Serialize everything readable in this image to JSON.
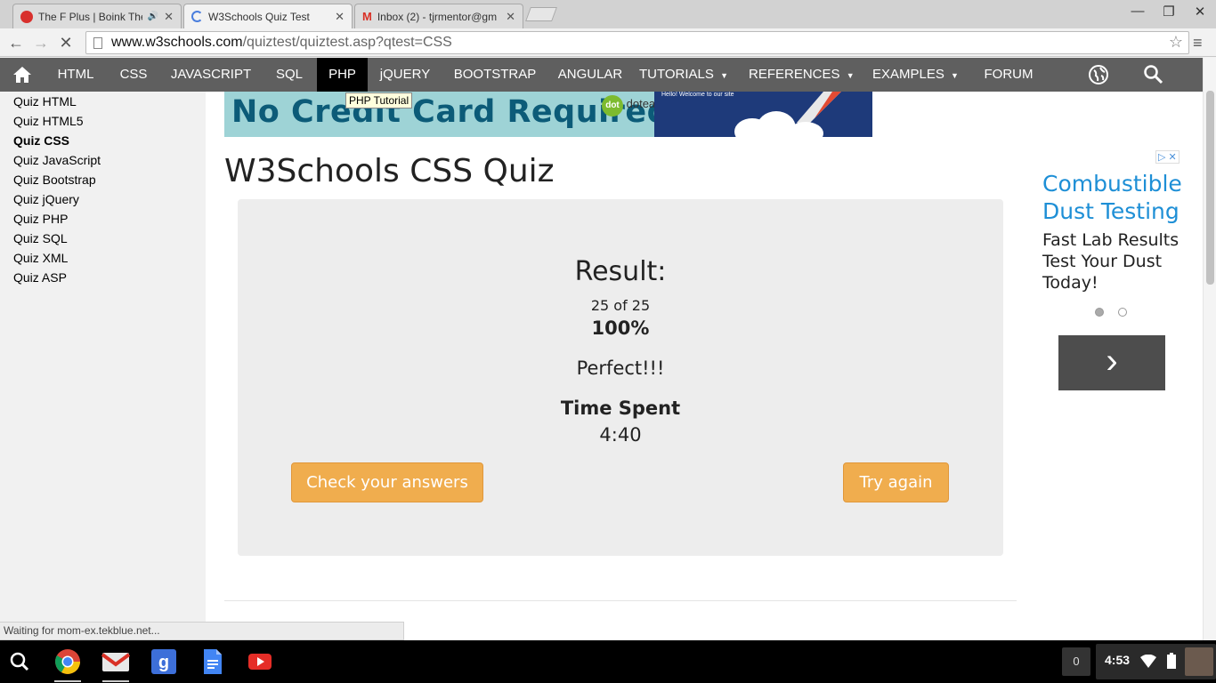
{
  "browser": {
    "tabs": [
      {
        "title": "The F Plus | Boink The",
        "active": false
      },
      {
        "title": "W3Schools Quiz Test",
        "active": true
      },
      {
        "title": "Inbox (2) - tjrmentor@gm",
        "active": false
      }
    ],
    "url_host": "www.w3schools.com",
    "url_path": "/quiztest/quiztest.asp?qtest=CSS"
  },
  "topnav": {
    "items": [
      "HTML",
      "CSS",
      "JAVASCRIPT",
      "SQL",
      "PHP",
      "jQUERY",
      "BOOTSTRAP",
      "ANGULAR",
      "TUTORIALS",
      "REFERENCES",
      "EXAMPLES",
      "FORUM"
    ],
    "selected": "PHP",
    "tooltip": "PHP Tutorial"
  },
  "sidebar": {
    "items": [
      "Quiz HTML",
      "Quiz HTML5",
      "Quiz CSS",
      "Quiz JavaScript",
      "Quiz Bootstrap",
      "Quiz jQuery",
      "Quiz PHP",
      "Quiz SQL",
      "Quiz XML",
      "Quiz ASP"
    ],
    "current": "Quiz CSS"
  },
  "banner": {
    "headline": "No Credit Card Required",
    "brand": "doteasy",
    "panel_text": "Hello! Welcome to our site"
  },
  "main": {
    "title": "W3Schools CSS Quiz",
    "result_heading": "Result:",
    "score": "25 of 25",
    "percent": "100%",
    "verdict": "Perfect!!!",
    "time_label": "Time Spent",
    "time_value": "4:40",
    "check_button": "Check your answers",
    "retry_button": "Try again"
  },
  "ad": {
    "title": "Combustible Dust Testing",
    "body": "Fast Lab Results Test Your Dust Today!",
    "next_glyph": "›"
  },
  "status": "Waiting for mom-ex.tekblue.net...",
  "shelf": {
    "notification_count": "0",
    "clock": "4:53"
  },
  "colors": {
    "nav_bg": "#5f5f5f",
    "button": "#f0ad4e",
    "ad_title": "#1e8fd6"
  }
}
